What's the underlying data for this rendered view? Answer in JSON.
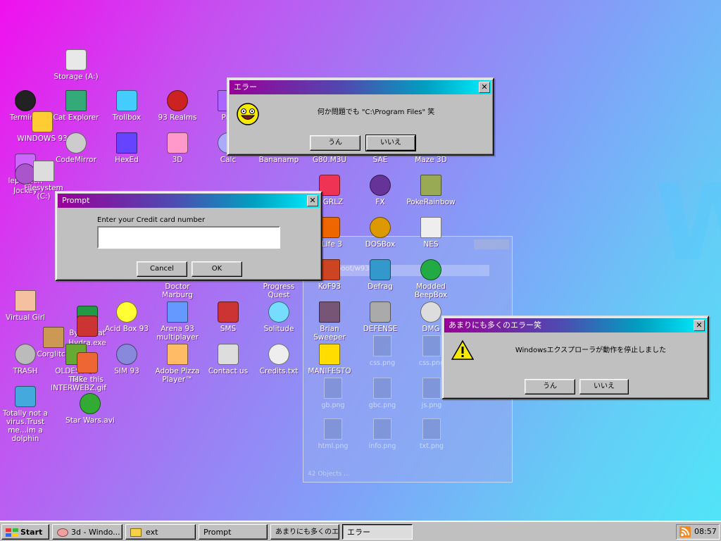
{
  "icons": [
    {
      "label": "Storage (A:)",
      "name": "storage-a-icon"
    },
    {
      "label": "Terminal",
      "name": "terminal-icon"
    },
    {
      "label": "Cat Explorer",
      "name": "cat-explorer-icon"
    },
    {
      "label": "Trollbox",
      "name": "trollbox-icon"
    },
    {
      "label": "93 Realms",
      "name": "93-realms-icon"
    },
    {
      "label": "Puk",
      "name": "puk-icon"
    },
    {
      "label": "WINDOWS 93",
      "name": "windows-93-icon"
    },
    {
      "label": "CodeMirror",
      "name": "codemirror-icon"
    },
    {
      "label": "HexEd",
      "name": "hexed-icon"
    },
    {
      "label": "3D",
      "name": "3d-icon"
    },
    {
      "label": "Calc",
      "name": "calc-icon"
    },
    {
      "label": "Bananamp",
      "name": "bananamp-icon"
    },
    {
      "label": "G80.M3U",
      "name": "g80-m3u-icon"
    },
    {
      "label": "SAE",
      "name": "sae-icon"
    },
    {
      "label": "Maze 3D",
      "name": "maze-3d-icon"
    },
    {
      "label": "lepeppen",
      "name": "lepeppen-icon"
    },
    {
      "label": "Jockey",
      "name": "jockey-icon"
    },
    {
      "label": "Filesystem (C:)",
      "name": "filesystem-c-icon"
    },
    {
      "label": "h GRLZ",
      "name": "grlz-icon"
    },
    {
      "label": "FX",
      "name": "fx-icon"
    },
    {
      "label": "PokeRainbow",
      "name": "pokerainbow-icon"
    },
    {
      "label": "f-Life 3",
      "name": "half-life-3-icon"
    },
    {
      "label": "DOSBox",
      "name": "dosbox-icon"
    },
    {
      "label": "NES",
      "name": "nes-icon"
    },
    {
      "label": "Doctor Marburg",
      "name": "doctor-marburg-icon"
    },
    {
      "label": "Progress Quest",
      "name": "progress-quest-icon"
    },
    {
      "label": "KoF93",
      "name": "kof93-icon"
    },
    {
      "label": "Defrag",
      "name": "defrag-icon"
    },
    {
      "label": "Modded BeepBox",
      "name": "modded-beepbox-icon"
    },
    {
      "label": "Virtual Girl",
      "name": "virtual-girl-icon"
    },
    {
      "label": "Byte Beat",
      "name": "byte-beat-icon"
    },
    {
      "label": "Acid Box 93",
      "name": "acid-box-93-icon"
    },
    {
      "label": "Arena 93 multiplayer",
      "name": "arena-93-icon"
    },
    {
      "label": "SMS",
      "name": "sms-icon"
    },
    {
      "label": "Solitude",
      "name": "solitude-icon"
    },
    {
      "label": "Brian Sweeper",
      "name": "brian-sweeper-icon"
    },
    {
      "label": "DEFENSE",
      "name": "defense-icon"
    },
    {
      "label": "DMG",
      "name": "dmg-icon"
    },
    {
      "label": "Corglitch",
      "name": "corglitch-icon"
    },
    {
      "label": "Hydra.exe",
      "name": "hydra-exe-icon"
    },
    {
      "label": "TRASH",
      "name": "trash-icon"
    },
    {
      "label": "OLDEST OF THE INTERWEBZ.gif",
      "name": "oldest-gif-icon"
    },
    {
      "label": "Take this",
      "name": "take-this-icon"
    },
    {
      "label": "SIM 93",
      "name": "sim-93-icon"
    },
    {
      "label": "Adobe Pizza Player™",
      "name": "adobe-pizza-icon"
    },
    {
      "label": "Contact us",
      "name": "contact-us-icon"
    },
    {
      "label": "Credits.txt",
      "name": "credits-txt-icon"
    },
    {
      "label": "MANIFESTO",
      "name": "manifesto-icon"
    },
    {
      "label": "Totally not a virus.Trust me...im a dolphin",
      "name": "dolphin-virus-icon"
    },
    {
      "label": "Star Wars.avi",
      "name": "star-wars-avi-icon"
    }
  ],
  "ghost_window": {
    "path": "/a/boot/w93/ext",
    "files": [
      "css.png",
      "css.png",
      "gb.png",
      "gbc.png",
      "js.png",
      "html.png",
      "info.png",
      "txt.png"
    ],
    "status": "42 Objects   ..."
  },
  "dialog_error_top": {
    "title": "エラー",
    "message": "何か問題でも \"C:\\Program Files\" 笑",
    "yes": "うん",
    "no": "いいえ",
    "close": "✕"
  },
  "dialog_prompt": {
    "title": "Prompt",
    "label": "Enter your Credit card number",
    "value": "",
    "cancel": "Cancel",
    "ok": "OK",
    "close": "✕"
  },
  "dialog_error_right": {
    "title": "あまりにも多くのエラー笑",
    "message": "Windowsエクスプローラが動作を停止しました",
    "yes": "うん",
    "no": "いいえ",
    "close": "✕"
  },
  "taskbar": {
    "start": "Start",
    "tasks": [
      "3d - Windo...",
      "ext",
      "Prompt",
      "あまりにも多くのエ...",
      "エラー"
    ],
    "clock": "08:57"
  },
  "colors": {
    "title_start": "#990099",
    "title_end": "#00f0ff",
    "desktop_start": "#f010ee",
    "desktop_end": "#4fe6f8"
  }
}
